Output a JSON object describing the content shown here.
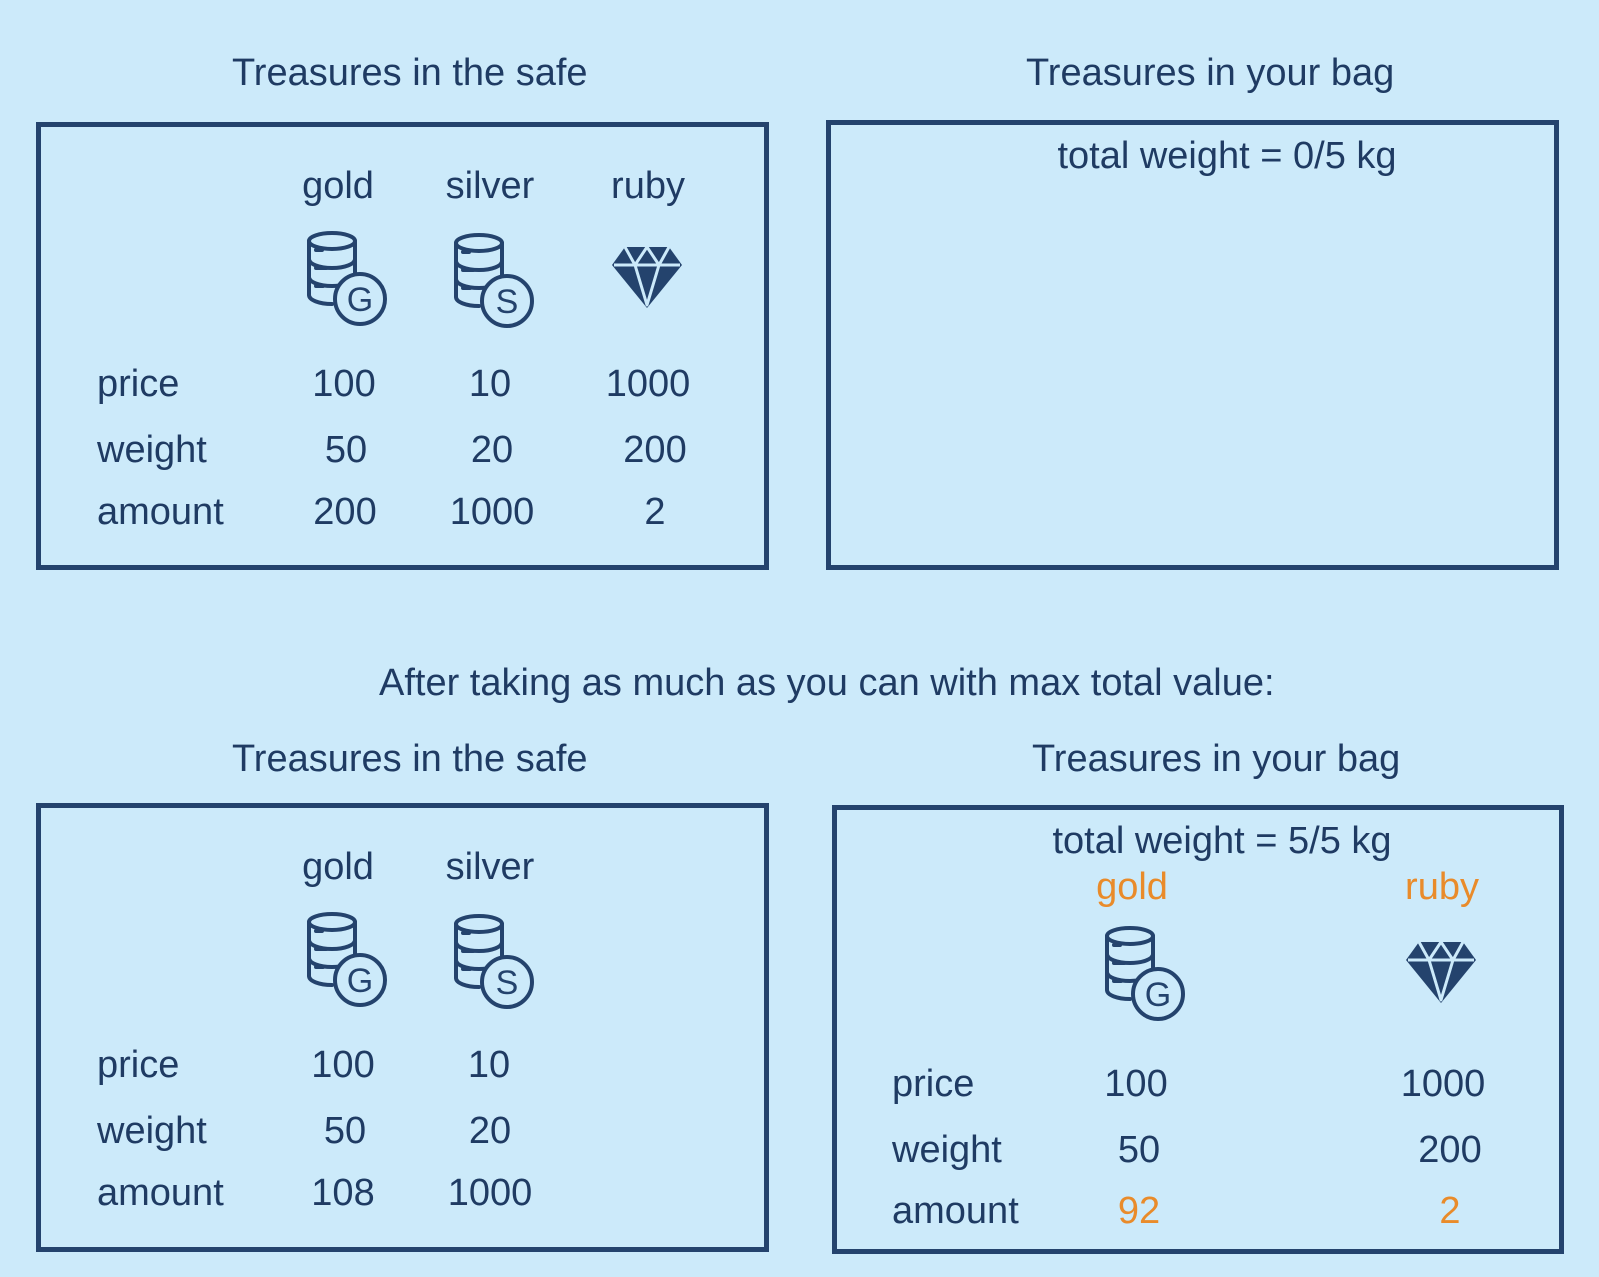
{
  "colors": {
    "background": "#cceafa",
    "ink": "#24436d",
    "highlight": "#e98b2a"
  },
  "top": {
    "safe_title": "Treasures in the safe",
    "bag_title": "Treasures in your bag",
    "bag_total": "total weight = 0/5 kg",
    "safe": {
      "row_labels": [
        "price",
        "weight",
        "amount"
      ],
      "items": [
        {
          "name": "gold",
          "icon": "gold-coins-icon",
          "coin_letter": "G",
          "price": "100",
          "weight": "50",
          "amount": "200"
        },
        {
          "name": "silver",
          "icon": "silver-coins-icon",
          "coin_letter": "S",
          "price": "10",
          "weight": "20",
          "amount": "1000"
        },
        {
          "name": "ruby",
          "icon": "ruby-gem-icon",
          "price": "1000",
          "weight": "200",
          "amount": "2"
        }
      ]
    }
  },
  "caption": "After taking as much as you can with max total value:",
  "bottom": {
    "safe_title": "Treasures in the safe",
    "bag_title": "Treasures in your bag",
    "bag_total": "total weight  = 5/5 kg",
    "safe": {
      "row_labels": [
        "price",
        "weight",
        "amount"
      ],
      "items": [
        {
          "name": "gold",
          "icon": "gold-coins-icon",
          "coin_letter": "G",
          "price": "100",
          "weight": "50",
          "amount": "108"
        },
        {
          "name": "silver",
          "icon": "silver-coins-icon",
          "coin_letter": "S",
          "price": "10",
          "weight": "20",
          "amount": "1000"
        }
      ]
    },
    "bag": {
      "row_labels": [
        "price",
        "weight",
        "amount"
      ],
      "items": [
        {
          "name": "gold",
          "icon": "gold-coins-icon",
          "coin_letter": "G",
          "price": "100",
          "weight": "50",
          "amount": "92"
        },
        {
          "name": "ruby",
          "icon": "ruby-gem-icon",
          "price": "1000",
          "weight": "200",
          "amount": "2"
        }
      ]
    }
  }
}
